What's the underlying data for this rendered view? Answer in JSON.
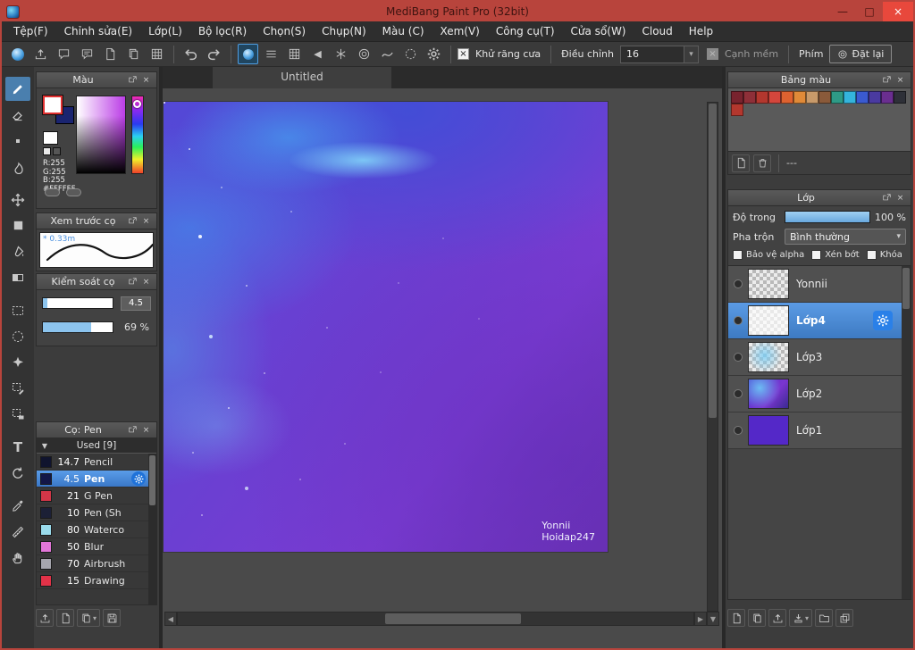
{
  "window": {
    "title": "MediBang Paint Pro (32bit)",
    "minimize_glyph": "—",
    "maximize_glyph": "□",
    "close_glyph": "×"
  },
  "colors": {
    "titlebar": "#b8443c",
    "close_button": "#e8483c",
    "accent_blue": "#4a8fd0",
    "layer_selected": "#3d7ac2",
    "slider_fill": "#8cc4ee"
  },
  "menu_bar": {
    "items": [
      "Tệp(F)",
      "Chỉnh sửa(E)",
      "Lớp(L)",
      "Bộ lọc(R)",
      "Chọn(S)",
      "Chụp(N)",
      "Màu (C)",
      "Xem(V)",
      "Công cụ(T)",
      "Cửa sổ(W)",
      "Cloud",
      "Help"
    ]
  },
  "toolbar": {
    "antialias_check_glyph": "×",
    "antialias_label": "Khử răng cưa",
    "adjust_label": "Điều chỉnh",
    "adjust_value": "16",
    "dropdown_caret": "▾",
    "softedge_check_glyph": "×",
    "softedge_label": "Cạnh mềm",
    "keys_label": "Phím",
    "reset_label": "Đặt lại",
    "mode_triangle_glyph": "◀"
  },
  "tool_strip": {
    "tools": [
      "brush",
      "eraser",
      "dot",
      "smudge",
      "move",
      "fill-rect",
      "bucket",
      "gradient",
      "select-rect",
      "lasso-select",
      "magic-wand",
      "select-pen",
      "select-eraser",
      "text",
      "rotate",
      "eyedropper",
      "measure",
      "hand"
    ],
    "text_tool_glyph": "T"
  },
  "color_panel": {
    "title": "Màu",
    "r_label": "R:255",
    "g_label": "G:255",
    "b_label": "B:255",
    "hex_label": "#FFFFFF"
  },
  "brush_preview_panel": {
    "title": "Xem trước cọ",
    "size_label": "* 0.33m"
  },
  "brush_control_panel": {
    "title": "Kiểm soát cọ",
    "size_value": "4.5",
    "opacity_value": "69 %"
  },
  "brush_list_panel": {
    "title": "Cọ: Pen",
    "group_caret": "▼",
    "group_label": "Used [9]",
    "brushes": [
      {
        "size": "14.7",
        "name": "Pencil",
        "color": "#10142e"
      },
      {
        "size": "4.5",
        "name": "Pen",
        "color": "#131747"
      },
      {
        "size": "21",
        "name": "G Pen",
        "color": "#d23648"
      },
      {
        "size": "10",
        "name": "Pen (Sh",
        "color": "#1c2036"
      },
      {
        "size": "80",
        "name": "Waterco",
        "color": "#9adcec"
      },
      {
        "size": "50",
        "name": "Blur",
        "color": "#e276d8"
      },
      {
        "size": "70",
        "name": "Airbrush",
        "color": "#a6a6ae"
      },
      {
        "size": "15",
        "name": "Drawing",
        "color": "#e23248"
      }
    ]
  },
  "canvas": {
    "tab_title": "Untitled",
    "watermark_line1": "Yonnii",
    "watermark_line2": "Hoidap247"
  },
  "palette_panel": {
    "title": "Bảng màu",
    "swatches": [
      "#78232e",
      "#8e2f38",
      "#b3372e",
      "#d4463c",
      "#de6230",
      "#e08a38",
      "#c89a6a",
      "#8a5a3a",
      "#2e9a86",
      "#34b4dc",
      "#3a5ad0",
      "#4a3aa0",
      "#6a2e90",
      "#2e3038",
      "#b3372e"
    ],
    "empty_label": "---"
  },
  "layers_panel": {
    "title": "Lớp",
    "opacity_label": "Độ trong",
    "opacity_value": "100 %",
    "blend_label": "Pha trộn",
    "blend_value": "Bình thường",
    "blend_caret": "▾",
    "check_alpha": "Bảo vệ alpha",
    "check_clip": "Xén bớt",
    "check_lock": "Khóa",
    "layers": [
      {
        "name": "Yonnii"
      },
      {
        "name": "Lớp4"
      },
      {
        "name": "Lớp3"
      },
      {
        "name": "Lớp2"
      },
      {
        "name": "Lớp1"
      }
    ]
  },
  "scrollbar": {
    "left_glyph": "◀",
    "right_glyph": "▶",
    "down_glyph": "▼"
  }
}
